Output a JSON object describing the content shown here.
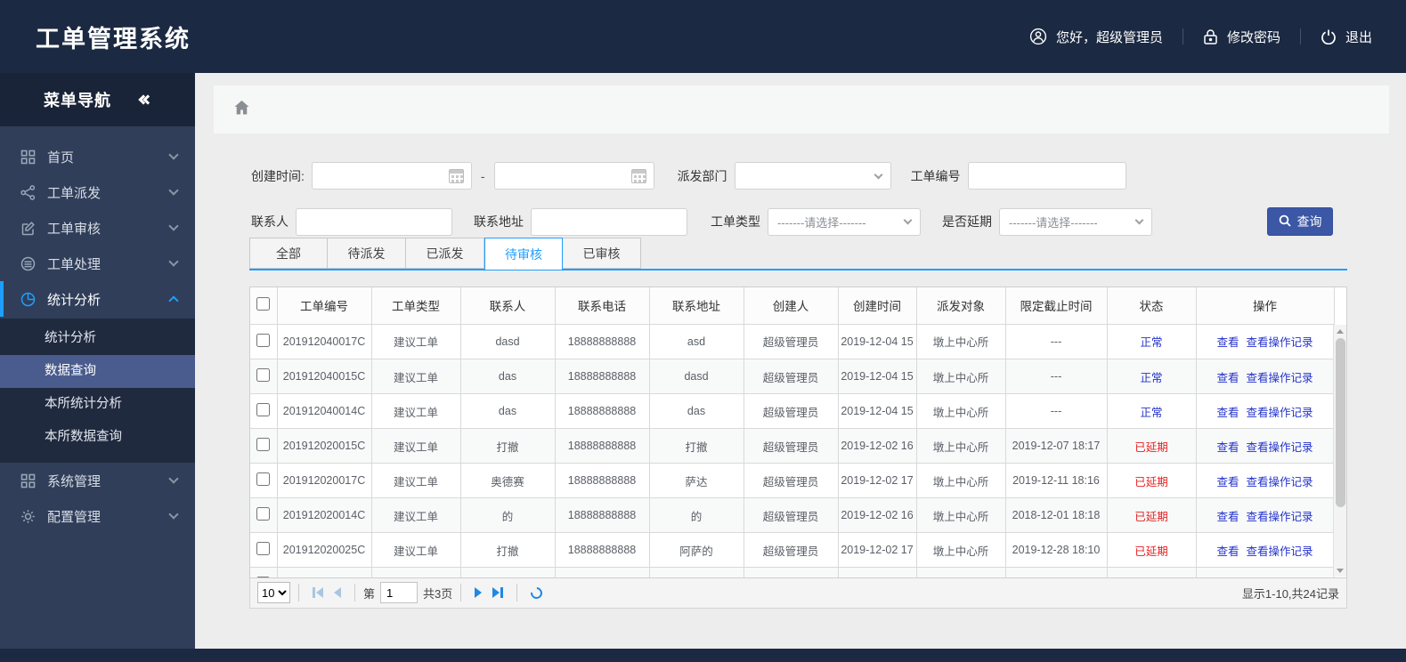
{
  "app": {
    "title": "工单管理系统"
  },
  "colors": {
    "navy": "#1b2942",
    "sidebar": "#303e59",
    "accent_blue": "#1e9fff",
    "button_blue": "#3b57a5",
    "link_blue": "#2433cc",
    "danger_red": "#e62222",
    "submenu_selected": "#4a5b8e"
  },
  "header": {
    "greeting": "您好，超级管理员",
    "greeting_icon": "user-circle-icon",
    "change_password": "修改密码",
    "change_password_icon": "lock-icon",
    "logout": "退出",
    "logout_icon": "power-icon"
  },
  "sidebar": {
    "title": "菜单导航",
    "collapse_icon": "double-chevron-left-icon",
    "items": [
      {
        "label": "首页",
        "icon": "grid-icon",
        "expanded": false
      },
      {
        "label": "工单派发",
        "icon": "share-icon",
        "expanded": false
      },
      {
        "label": "工单审核",
        "icon": "edit-icon",
        "expanded": false
      },
      {
        "label": "工单处理",
        "icon": "process-icon",
        "expanded": false
      },
      {
        "label": "统计分析",
        "icon": "pie-chart-icon",
        "expanded": true,
        "submenu": [
          {
            "label": "统计分析",
            "selected": false
          },
          {
            "label": "数据查询",
            "selected": true
          },
          {
            "label": "本所统计分析",
            "selected": false
          },
          {
            "label": "本所数据查询",
            "selected": false
          }
        ]
      },
      {
        "label": "系统管理",
        "icon": "modules-icon",
        "expanded": false
      },
      {
        "label": "配置管理",
        "icon": "gear-icon",
        "expanded": false
      }
    ]
  },
  "breadcrumb": {
    "home_icon": "home-icon"
  },
  "filters": {
    "create_time_label": "创建时间:",
    "date_from_value": "",
    "date_separator": "-",
    "date_to_value": "",
    "dispatch_dept_label": "派发部门",
    "dispatch_dept_value": "",
    "order_no_label": "工单编号",
    "order_no_value": "",
    "contact_label": "联系人",
    "contact_value": "",
    "address_label": "联系地址",
    "address_value": "",
    "order_type_label": "工单类型",
    "order_type_placeholder": "-------请选择-------",
    "delay_label": "是否延期",
    "delay_placeholder": "-------请选择-------",
    "search_button": "查询",
    "search_icon": "search-icon"
  },
  "tabs": [
    {
      "label": "全部",
      "active": false
    },
    {
      "label": "待派发",
      "active": false
    },
    {
      "label": "已派发",
      "active": false
    },
    {
      "label": "待审核",
      "active": true
    },
    {
      "label": "已审核",
      "active": false
    }
  ],
  "table": {
    "columns": [
      "工单编号",
      "工单类型",
      "联系人",
      "联系电话",
      "联系地址",
      "创建人",
      "创建时间",
      "派发对象",
      "限定截止时间",
      "状态",
      "操作"
    ],
    "action_labels": {
      "view": "查看",
      "view_log": "查看操作记录"
    },
    "rows": [
      {
        "order_no": "201912040017C",
        "type": "建议工单",
        "contact": "dasd",
        "phone": "18888888888",
        "address": "asd",
        "creator": "超级管理员",
        "created": "2019-12-04 15",
        "target": "墩上中心所",
        "deadline": "---",
        "status": "正常",
        "status_type": "normal"
      },
      {
        "order_no": "201912040015C",
        "type": "建议工单",
        "contact": "das",
        "phone": "18888888888",
        "address": "dasd",
        "creator": "超级管理员",
        "created": "2019-12-04 15",
        "target": "墩上中心所",
        "deadline": "---",
        "status": "正常",
        "status_type": "normal"
      },
      {
        "order_no": "201912040014C",
        "type": "建议工单",
        "contact": "das",
        "phone": "18888888888",
        "address": "das",
        "creator": "超级管理员",
        "created": "2019-12-04 15",
        "target": "墩上中心所",
        "deadline": "---",
        "status": "正常",
        "status_type": "normal"
      },
      {
        "order_no": "201912020015C",
        "type": "建议工单",
        "contact": "打撤",
        "phone": "18888888888",
        "address": "打撤",
        "creator": "超级管理员",
        "created": "2019-12-02 16",
        "target": "墩上中心所",
        "deadline": "2019-12-07 18:17",
        "status": "已延期",
        "status_type": "delayed"
      },
      {
        "order_no": "201912020017C",
        "type": "建议工单",
        "contact": "奥德赛",
        "phone": "18888888888",
        "address": "萨达",
        "creator": "超级管理员",
        "created": "2019-12-02 17",
        "target": "墩上中心所",
        "deadline": "2019-12-11 18:16",
        "status": "已延期",
        "status_type": "delayed"
      },
      {
        "order_no": "201912020014C",
        "type": "建议工单",
        "contact": "的",
        "phone": "18888888888",
        "address": "的",
        "creator": "超级管理员",
        "created": "2019-12-02 16",
        "target": "墩上中心所",
        "deadline": "2018-12-01 18:18",
        "status": "已延期",
        "status_type": "delayed"
      },
      {
        "order_no": "201912020025C",
        "type": "建议工单",
        "contact": "打撤",
        "phone": "18888888888",
        "address": "阿萨的",
        "creator": "超级管理员",
        "created": "2019-12-02 17",
        "target": "墩上中心所",
        "deadline": "2019-12-28 18:10",
        "status": "已延期",
        "status_type": "delayed"
      }
    ]
  },
  "pagination": {
    "page_size_options": [
      "10"
    ],
    "page_size": "10",
    "page_label": "第",
    "current_page": "1",
    "total_pages_label": "共3页",
    "summary": "显示1-10,共24记录"
  }
}
